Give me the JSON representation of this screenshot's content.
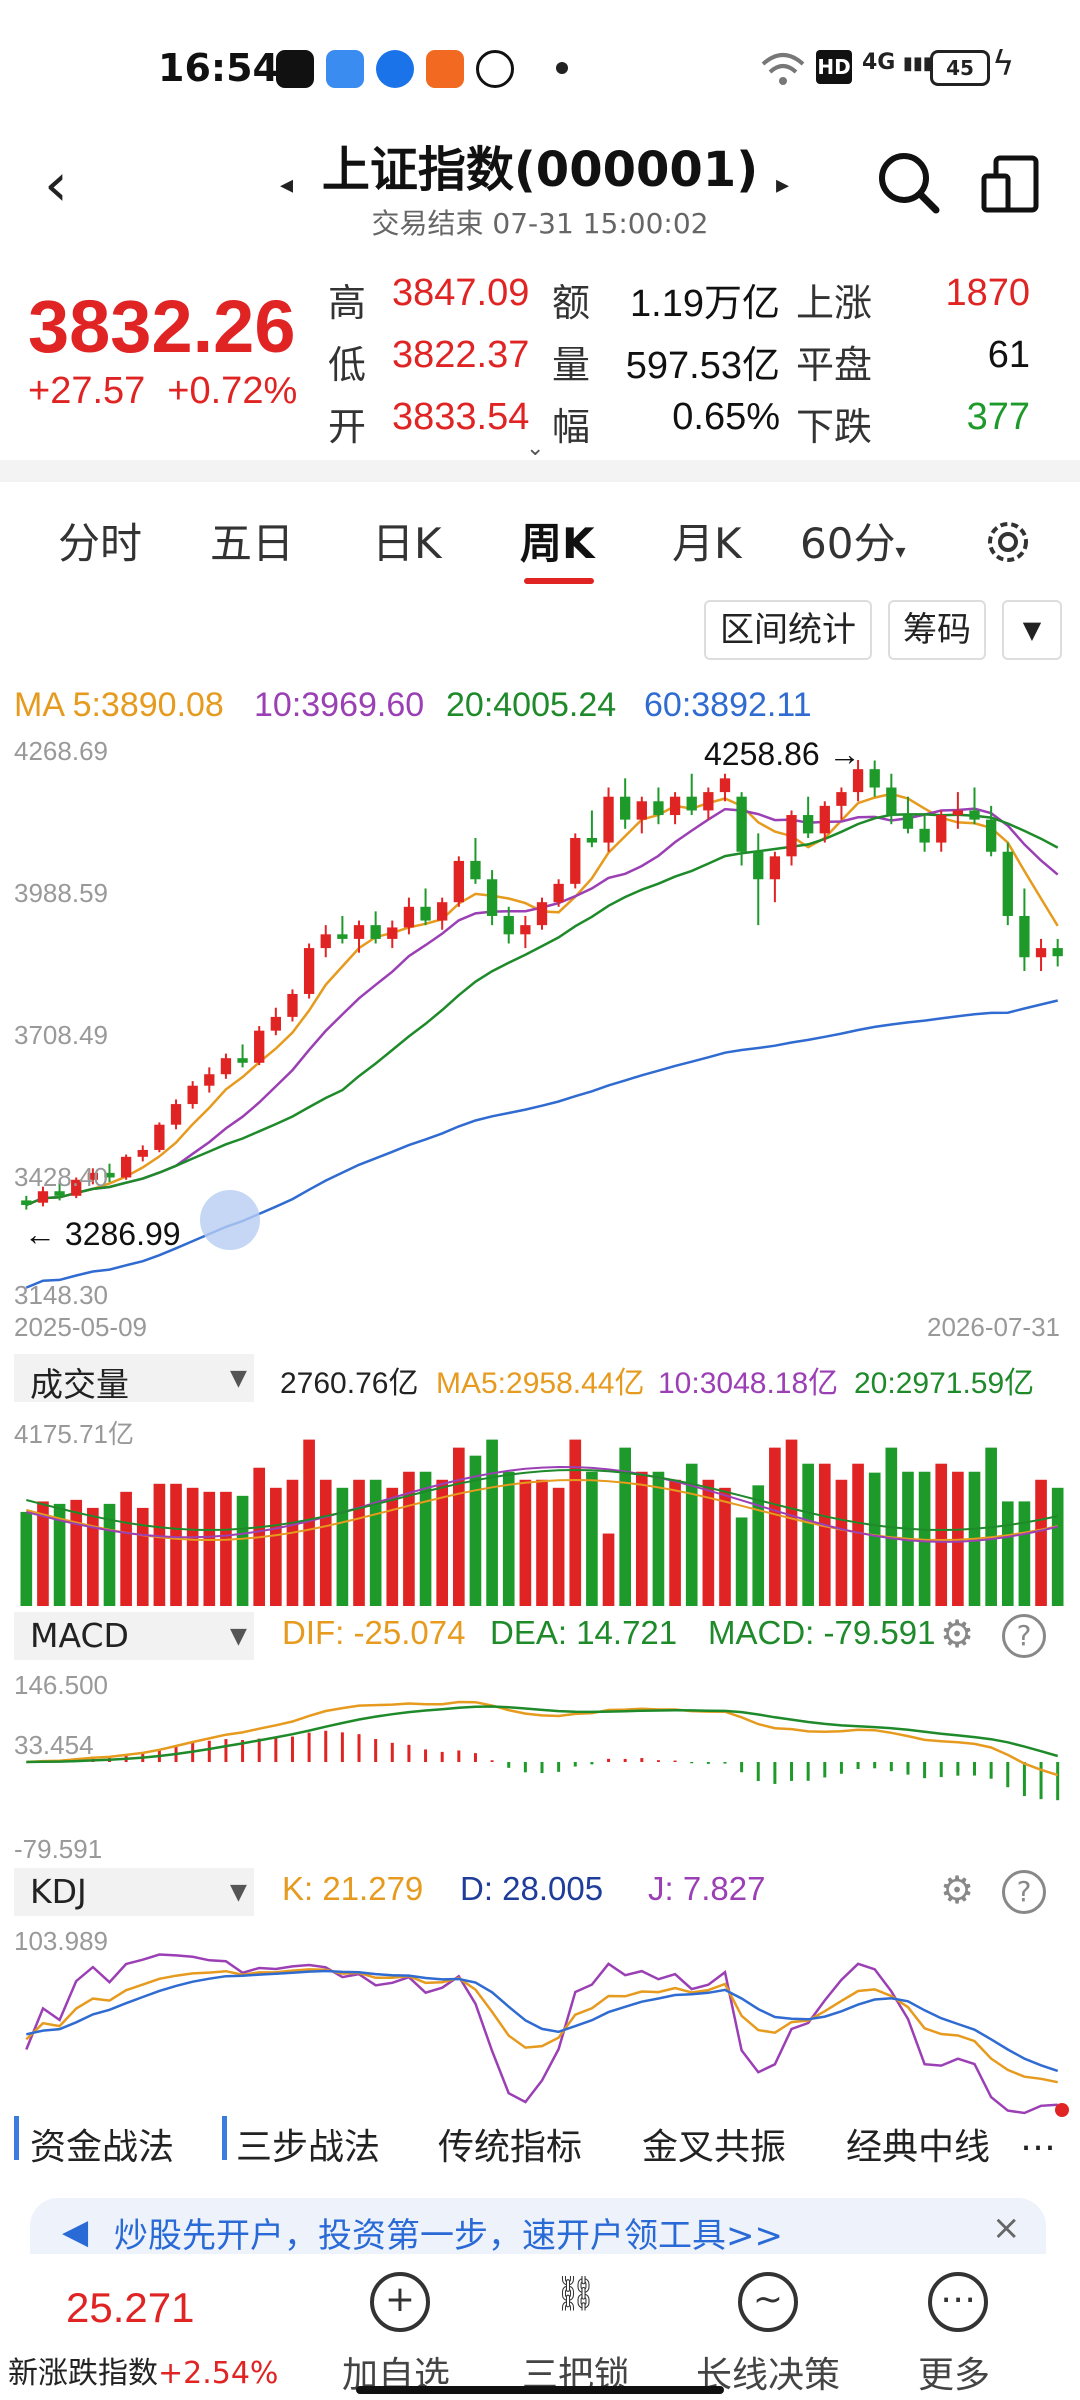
{
  "status_bar": {
    "time": "16:54",
    "network": "4G",
    "battery": "45",
    "hd": "HD"
  },
  "header": {
    "title": "上证指数(000001)",
    "subtitle": "交易结束 07-31 15:00:02",
    "back_icon": "chevron-left-icon",
    "prev_icon": "caret-left-icon",
    "next_icon": "caret-right-icon",
    "search_icon": "search-icon",
    "menu_icon": "split-panel-icon"
  },
  "quote": {
    "price": "3832.26",
    "change": "+27.57",
    "change_pct": "+0.72%",
    "high_label": "高",
    "high": "3847.09",
    "low_label": "低",
    "low": "3822.37",
    "open_label": "开",
    "open": "3833.54",
    "amount_label": "额",
    "amount": "1.19万亿",
    "volume_label": "量",
    "volume": "597.53亿",
    "amp_label": "幅",
    "amp": "0.65%",
    "up_label": "上涨",
    "up": "1870",
    "flat_label": "平盘",
    "flat": "61",
    "down_label": "下跌",
    "down": "377"
  },
  "tabs": [
    "分时",
    "五日",
    "日K",
    "周K",
    "月K",
    "60分"
  ],
  "active_tab": "周K",
  "tools": {
    "range_stat": "区间统计",
    "chips": "筹码"
  },
  "ma_line": {
    "ma5": "MA 5:3890.08",
    "ma10": "10:3969.60",
    "ma20": "20:4005.24",
    "ma60": "60:3892.11"
  },
  "kline_axis": {
    "y1": "4268.69",
    "y2": "3988.59",
    "y3": "3708.49",
    "y4": "3428.40",
    "y5": "3148.30",
    "start_date": "2025-05-09",
    "end_date": "2026-07-31",
    "high_mark": "4258.86",
    "low_mark": "3286.99"
  },
  "volume_panel": {
    "label": "成交量",
    "value": "2760.76亿",
    "ma5": "MA5:2958.44亿",
    "ma10": "10:3048.18亿",
    "ma20": "20:2971.59亿",
    "ymax": "4175.71亿"
  },
  "macd_panel": {
    "label": "MACD",
    "dif": "DIF: -25.074",
    "dea": "DEA: 14.721",
    "macd": "MACD: -79.591",
    "y1": "146.500",
    "y2": "33.454",
    "y3": "-79.591"
  },
  "kdj_panel": {
    "label": "KDJ",
    "k": "K: 21.279",
    "d": "D: 28.005",
    "j": "J: 7.827",
    "y1": "103.989"
  },
  "strategy_tabs": [
    "资金战法",
    "三步战法",
    "传统指标",
    "金叉共振",
    "经典中线"
  ],
  "banner": {
    "text": "炒股先开户，投资第一步，速开户领工具>>"
  },
  "bottom_nav": {
    "index_value": "25.271",
    "index_name": "新涨跌指数",
    "index_change": "+2.54%",
    "items": [
      "加自选",
      "三把锁",
      "长线决策",
      "更多"
    ]
  },
  "colors": {
    "up": "#e02424",
    "down": "#1e9a2a",
    "ma5": "#e69a1e",
    "ma10": "#9b3fb5",
    "ma20": "#1e8a2a",
    "ma60": "#2f6bd0"
  },
  "chart_data": {
    "type": "candlestick",
    "candles": [
      [
        3300,
        3310,
        3280,
        3290
      ],
      [
        3295,
        3330,
        3286.99,
        3320
      ],
      [
        3320,
        3340,
        3300,
        3310
      ],
      [
        3310,
        3350,
        3305,
        3345
      ],
      [
        3345,
        3370,
        3335,
        3360
      ],
      [
        3360,
        3380,
        3340,
        3350
      ],
      [
        3350,
        3400,
        3345,
        3395
      ],
      [
        3395,
        3420,
        3385,
        3410
      ],
      [
        3410,
        3470,
        3405,
        3465
      ],
      [
        3465,
        3520,
        3455,
        3510
      ],
      [
        3510,
        3560,
        3500,
        3550
      ],
      [
        3550,
        3590,
        3535,
        3575
      ],
      [
        3575,
        3620,
        3565,
        3610
      ],
      [
        3610,
        3640,
        3590,
        3600
      ],
      [
        3600,
        3680,
        3595,
        3670
      ],
      [
        3670,
        3720,
        3660,
        3700
      ],
      [
        3700,
        3760,
        3690,
        3750
      ],
      [
        3750,
        3860,
        3740,
        3850
      ],
      [
        3850,
        3900,
        3830,
        3880
      ],
      [
        3880,
        3920,
        3860,
        3870
      ],
      [
        3870,
        3910,
        3840,
        3900
      ],
      [
        3900,
        3930,
        3860,
        3870
      ],
      [
        3870,
        3910,
        3850,
        3895
      ],
      [
        3895,
        3960,
        3880,
        3940
      ],
      [
        3940,
        3980,
        3900,
        3910
      ],
      [
        3910,
        3960,
        3890,
        3950
      ],
      [
        3950,
        4050,
        3940,
        4040
      ],
      [
        4040,
        4090,
        3990,
        4000
      ],
      [
        4000,
        4020,
        3900,
        3920
      ],
      [
        3920,
        3940,
        3860,
        3880
      ],
      [
        3880,
        3920,
        3850,
        3900
      ],
      [
        3900,
        3960,
        3890,
        3950
      ],
      [
        3950,
        4000,
        3940,
        3990
      ],
      [
        3990,
        4100,
        3980,
        4090
      ],
      [
        4090,
        4150,
        4070,
        4080
      ],
      [
        4080,
        4200,
        4060,
        4180
      ],
      [
        4180,
        4220,
        4110,
        4130
      ],
      [
        4130,
        4180,
        4100,
        4170
      ],
      [
        4170,
        4200,
        4120,
        4140
      ],
      [
        4140,
        4190,
        4120,
        4180
      ],
      [
        4180,
        4230,
        4140,
        4150
      ],
      [
        4150,
        4200,
        4130,
        4190
      ],
      [
        4190,
        4230,
        4170,
        4220
      ],
      [
        4180,
        4190,
        4030,
        4060
      ],
      [
        4060,
        4100,
        3900,
        4000
      ],
      [
        4000,
        4060,
        3950,
        4050
      ],
      [
        4050,
        4150,
        4030,
        4140
      ],
      [
        4140,
        4180,
        4090,
        4100
      ],
      [
        4100,
        4170,
        4080,
        4160
      ],
      [
        4160,
        4200,
        4130,
        4190
      ],
      [
        4190,
        4260,
        4170,
        4240
      ],
      [
        4240,
        4258.86,
        4180,
        4200
      ],
      [
        4200,
        4230,
        4120,
        4140
      ],
      [
        4140,
        4180,
        4100,
        4110
      ],
      [
        4110,
        4140,
        4060,
        4080
      ],
      [
        4080,
        4150,
        4060,
        4140
      ],
      [
        4140,
        4190,
        4110,
        4150
      ],
      [
        4150,
        4200,
        4120,
        4130
      ],
      [
        4130,
        4160,
        4050,
        4060
      ],
      [
        4060,
        4080,
        3900,
        3920
      ],
      [
        3920,
        3980,
        3800,
        3830
      ],
      [
        3830,
        3870,
        3800,
        3850
      ],
      [
        3850,
        3870,
        3810,
        3832.26
      ]
    ],
    "ylim": [
      3148.3,
      4268.69
    ],
    "x_range": [
      "2025-05-09",
      "2026-07-31"
    ]
  }
}
